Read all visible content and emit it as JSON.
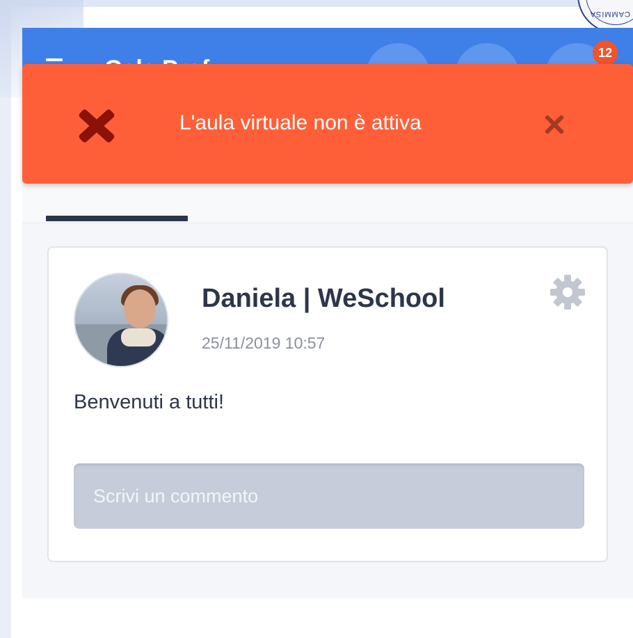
{
  "header": {
    "title": "Gala Prof",
    "notification_count": "12"
  },
  "toast": {
    "message": "L'aula virtuale non è attiva",
    "color": "#ff5f38"
  },
  "post": {
    "author": "Daniela | WeSchool",
    "timestamp": "25/11/2019 10:57",
    "body": "Benvenuti a tutti!",
    "comment_placeholder": "Scrivi un commento"
  },
  "seal": {
    "text": "S. CAMMISA"
  },
  "icons": {
    "menu": "hamburger-menu-icon",
    "chat": "chat-icon",
    "location": "location-icon",
    "bell": "bell-icon",
    "error": "error-x-icon",
    "close": "close-icon",
    "settings": "gear-icon"
  },
  "colors": {
    "primary": "#3f80e8",
    "error": "#ff5f38",
    "badge": "#f0542c"
  }
}
